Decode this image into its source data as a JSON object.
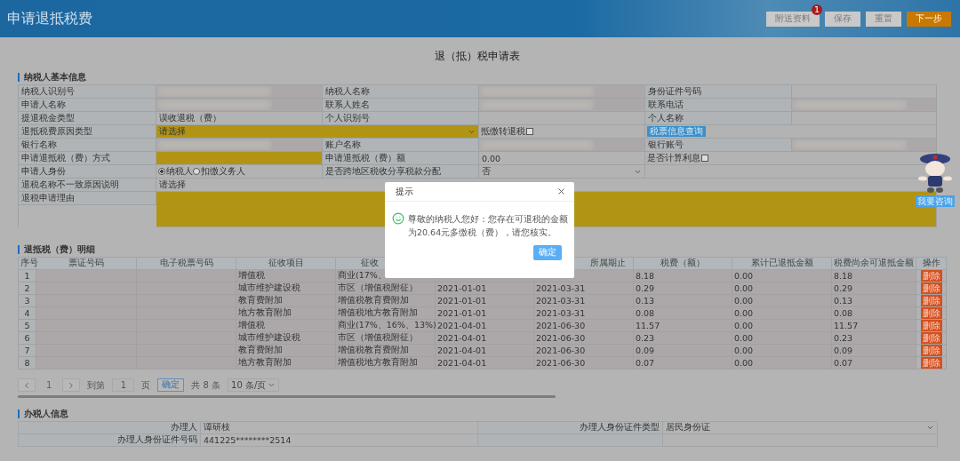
{
  "header": {
    "title": "申请退抵税费",
    "buttons": [
      {
        "label": "附送资料",
        "kind": "plain",
        "badge": "1"
      },
      {
        "label": "保存",
        "kind": "plain"
      },
      {
        "label": "重置",
        "kind": "plain"
      },
      {
        "label": "下一步",
        "kind": "primary"
      }
    ]
  },
  "form_title": "退（抵）税申请表",
  "taxpayer": {
    "heading": "纳税人基本信息",
    "rows": [
      [
        {
          "kind": "label",
          "text": "纳税人识别号"
        },
        {
          "kind": "redacted"
        },
        {
          "kind": "label",
          "text": "纳税人名称"
        },
        {
          "kind": "redacted"
        },
        {
          "kind": "label",
          "text": "身份证件号码"
        },
        {
          "kind": "value"
        }
      ],
      [
        {
          "kind": "label",
          "text": "申请人名称"
        },
        {
          "kind": "redacted"
        },
        {
          "kind": "label",
          "text": "联系人姓名"
        },
        {
          "kind": "redacted"
        },
        {
          "kind": "label",
          "text": "联系电话"
        },
        {
          "kind": "redacted"
        }
      ],
      [
        {
          "kind": "label",
          "text": "提退税金类型"
        },
        {
          "kind": "value",
          "text": "误收退税（费）"
        },
        {
          "kind": "label",
          "text": "个人识别号"
        },
        {
          "kind": "value"
        },
        {
          "kind": "label",
          "text": "个人名称"
        },
        {
          "kind": "value"
        }
      ],
      [
        {
          "kind": "label",
          "text": "退抵税费原因类型"
        },
        {
          "kind": "select",
          "text": "请选择",
          "required": true
        },
        {
          "kind": "select-toggle",
          "required": true
        },
        {
          "kind": "checkbox",
          "text": "抵缴转退税",
          "checked": false
        },
        {
          "kind": "button",
          "text": "税票信息查询"
        }
      ],
      [
        {
          "kind": "label",
          "text": "银行名称"
        },
        {
          "kind": "redacted"
        },
        {
          "kind": "label",
          "text": "账户名称"
        },
        {
          "kind": "redacted"
        },
        {
          "kind": "label",
          "text": "银行账号"
        },
        {
          "kind": "redacted"
        }
      ],
      [
        {
          "kind": "label",
          "text": "申请退抵税（费）方式"
        },
        {
          "kind": "input",
          "required": true
        },
        {
          "kind": "label",
          "text": "申请退抵税（费）额"
        },
        {
          "kind": "value",
          "text": "0.00"
        },
        {
          "kind": "checkbox",
          "text": "是否计算利息",
          "checked": false
        }
      ],
      [
        {
          "kind": "label",
          "text": "申请人身份"
        },
        {
          "kind": "radio",
          "options": [
            {
              "label": "纳税人",
              "selected": true
            },
            {
              "label": "扣缴义务人",
              "selected": false
            }
          ]
        },
        {
          "kind": "label",
          "text": "是否跨地区税收分享税款分配"
        },
        {
          "kind": "select",
          "text": "否",
          "required": false
        },
        {
          "kind": "value"
        }
      ],
      [
        {
          "kind": "label",
          "text": "退税名称不一致原因说明"
        },
        {
          "kind": "value",
          "text": "请选择"
        }
      ],
      [
        {
          "kind": "label",
          "text": "退税申请理由"
        },
        {
          "kind": "textarea",
          "required": true
        }
      ]
    ]
  },
  "details": {
    "heading": "退抵税（费）明细",
    "columns": [
      {
        "label": "序号"
      },
      {
        "label": "票证号码"
      },
      {
        "label": "电子税票号码"
      },
      {
        "label": "征收项目"
      },
      {
        "label": "征收"
      },
      {},
      {
        "label": "所属期止"
      },
      {
        "label": "税费（额）"
      },
      {
        "label": "累计已退抵金额"
      },
      {
        "label": "税费尚余可退抵金额"
      },
      {
        "label": "操作"
      }
    ],
    "rows": [
      {
        "no": "1",
        "item": "增值税",
        "category": "商业(17%、",
        "amount": "8.18",
        "refunded": "0.00",
        "remaining": "8.18",
        "action": "删除"
      },
      {
        "no": "2",
        "item": "城市维护建设税",
        "category": "市区（增值税附征）",
        "start": "2021-01-01",
        "end": "2021-03-31",
        "amount": "0.29",
        "refunded": "0.00",
        "remaining": "0.29",
        "action": "删除"
      },
      {
        "no": "3",
        "item": "教育费附加",
        "category": "增值税教育费附加",
        "start": "2021-01-01",
        "end": "2021-03-31",
        "amount": "0.13",
        "refunded": "0.00",
        "remaining": "0.13",
        "action": "删除"
      },
      {
        "no": "4",
        "item": "地方教育附加",
        "category": "增值税地方教育附加",
        "start": "2021-01-01",
        "end": "2021-03-31",
        "amount": "0.08",
        "refunded": "0.00",
        "remaining": "0.08",
        "action": "删除"
      },
      {
        "no": "5",
        "item": "增值税",
        "category": "商业(17%、16%、13%)",
        "start": "2021-04-01",
        "end": "2021-06-30",
        "amount": "11.57",
        "refunded": "0.00",
        "remaining": "11.57",
        "action": "删除"
      },
      {
        "no": "6",
        "item": "城市维护建设税",
        "category": "市区（增值税附征）",
        "start": "2021-04-01",
        "end": "2021-06-30",
        "amount": "0.23",
        "refunded": "0.00",
        "remaining": "0.23",
        "action": "删除"
      },
      {
        "no": "7",
        "item": "教育费附加",
        "category": "增值税教育费附加",
        "start": "2021-04-01",
        "end": "2021-06-30",
        "amount": "0.09",
        "refunded": "0.00",
        "remaining": "0.09",
        "action": "删除"
      },
      {
        "no": "8",
        "item": "地方教育附加",
        "category": "增值税地方教育附加",
        "start": "2021-04-01",
        "end": "2021-06-30",
        "amount": "0.07",
        "refunded": "0.00",
        "remaining": "0.07",
        "action": "删除"
      }
    ],
    "pagination": {
      "pages": [
        {
          "label": "1",
          "selected": true
        }
      ],
      "goto_label": "到第",
      "goto_value": "1",
      "page_unit": "页",
      "confirm": "确定",
      "total": "共 8 条",
      "page_size": "10 条/页"
    }
  },
  "agent": {
    "heading": "办税人信息",
    "rows": [
      [
        {
          "label": "办理人",
          "value": "谭研枝"
        },
        {
          "label": "办理人身份证件类型",
          "value": "居民身份证",
          "kind": "select"
        }
      ],
      [
        {
          "label": "办理人身份证件号码",
          "value": "441225********2514"
        },
        {}
      ]
    ]
  },
  "helper": {
    "button": "我要咨询"
  },
  "dialog": {
    "title": "提示",
    "message": "尊敬的纳税人您好：您存在可退税的金额为20.64元多缴税（费），请您核实。",
    "button": "确定"
  }
}
